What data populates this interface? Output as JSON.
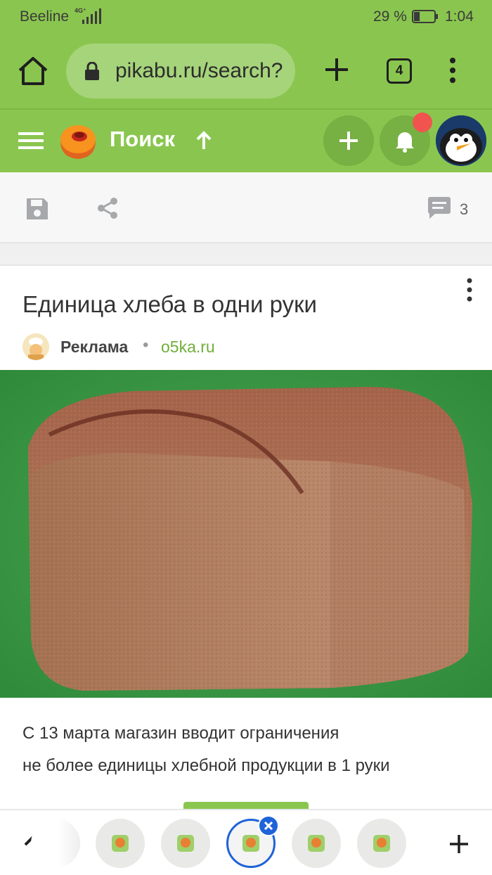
{
  "status_bar": {
    "carrier": "Beeline",
    "network": "4G⁺",
    "battery_percent": "29 %",
    "battery_level": 0.29,
    "time": "1:04"
  },
  "browser": {
    "url": "pikabu.ru/search?",
    "tab_count": "4"
  },
  "site_header": {
    "title": "Поиск",
    "accent_color": "#8ac64f",
    "notification_dot_color": "#f1544f"
  },
  "post_actions": {
    "comment_count": "3"
  },
  "post": {
    "title": "Единица хлеба в одни руки",
    "author": "Реклама",
    "separator": "•",
    "source": "o5ka.ru",
    "text_line_1": "С 13 марта магазин вводит ограничения",
    "text_line_2": "не более единицы хлебной продукции в 1 руки"
  },
  "tab_strip": {
    "active_tab_color": "#1f63d8"
  },
  "icons": [
    "home-icon",
    "lock-icon",
    "plus-icon",
    "tabs-counter-icon",
    "more-vert-icon",
    "burger-icon",
    "pikabu-logo",
    "arrow-up-icon",
    "bell-icon",
    "save-icon",
    "share-icon",
    "comment-icon",
    "chevron-up-icon",
    "close-icon"
  ]
}
